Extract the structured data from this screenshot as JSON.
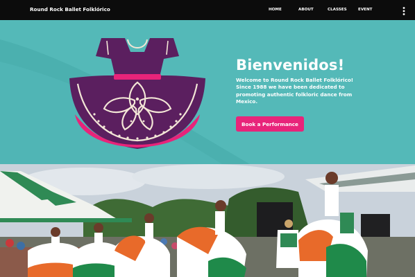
{
  "header": {
    "site_title": "Round Rock Ballet Folklórico",
    "nav": [
      {
        "label": "HOME"
      },
      {
        "label": "ABOUT"
      },
      {
        "label": "CLASSES"
      },
      {
        "label": "EVENT"
      }
    ],
    "more_icon": "vertical-ellipsis-icon"
  },
  "hero": {
    "title": "Bienvenidos!",
    "description": "Welcome to Round Rock Ballet Folklórico! Since 1988 we have been dedicated to promoting authentic folkloric dance from Mexico.",
    "cta_label": "Book a Performance",
    "illustration_icon": "folklorico-dress-icon"
  },
  "photo": {
    "subject": "dancers-performing-photo"
  },
  "colors": {
    "topbar": "#0c0c0c",
    "hero_bg": "#54b9b8",
    "hero_wave": "#3fa9a8",
    "dress_purple": "#5b1f5f",
    "dress_pink": "#e8247a",
    "cta_bg": "#e8247a",
    "text_light": "#ffffff"
  }
}
